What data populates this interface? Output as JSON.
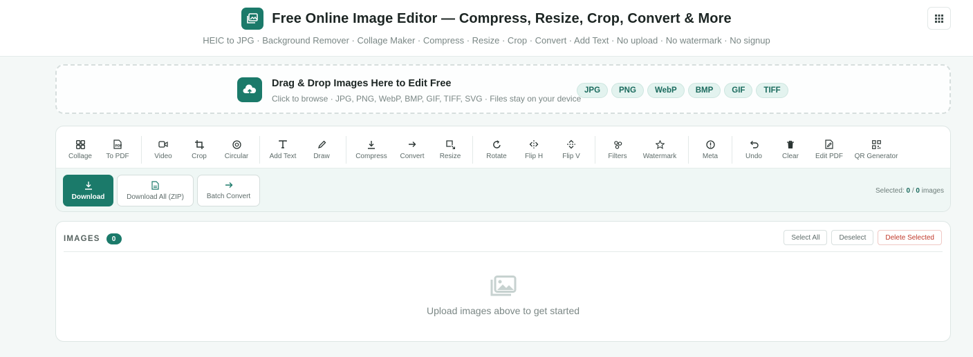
{
  "header": {
    "title": "Free Online Image Editor — Compress, Resize, Crop, Convert & More",
    "subtitle": "HEIC to JPG · Background Remover · Collage Maker · Compress · Resize · Crop · Convert · Add Text · No upload · No watermark · No signup",
    "logo_icon": "image-icon",
    "apps_icon": "grid-icon"
  },
  "dropzone": {
    "title": "Drag & Drop Images Here to Edit Free",
    "subtitle": "Click to browse · JPG, PNG, WebP, BMP, GIF, TIFF, SVG · Files stay on your device",
    "icon": "cloud-upload-icon",
    "formats": [
      "JPG",
      "PNG",
      "WebP",
      "BMP",
      "GIF",
      "TIFF"
    ]
  },
  "toolbar": {
    "tools": [
      {
        "label": "Collage",
        "icon": "grid-icon"
      },
      {
        "label": "To PDF",
        "icon": "pdf-icon"
      },
      {
        "label": "Video",
        "icon": "video-icon"
      },
      {
        "label": "Crop",
        "icon": "crop-icon"
      },
      {
        "label": "Circular",
        "icon": "circle-icon"
      },
      {
        "label": "Add Text",
        "icon": "text-icon"
      },
      {
        "label": "Draw",
        "icon": "pencil-icon"
      },
      {
        "label": "Compress",
        "icon": "download-icon"
      },
      {
        "label": "Convert",
        "icon": "arrow-right-icon"
      },
      {
        "label": "Resize",
        "icon": "resize-icon"
      },
      {
        "label": "Rotate",
        "icon": "rotate-icon"
      },
      {
        "label": "Flip H",
        "icon": "flip-h-icon"
      },
      {
        "label": "Flip V",
        "icon": "flip-v-icon"
      },
      {
        "label": "Filters",
        "icon": "filters-icon"
      },
      {
        "label": "Watermark",
        "icon": "star-icon"
      },
      {
        "label": "Meta",
        "icon": "info-icon"
      },
      {
        "label": "Undo",
        "icon": "undo-icon"
      },
      {
        "label": "Clear",
        "icon": "trash-icon"
      },
      {
        "label": "Edit PDF",
        "icon": "edit-pdf-icon"
      },
      {
        "label": "QR Generator",
        "icon": "qr-icon"
      }
    ]
  },
  "actions": {
    "download": "Download",
    "download_all": "Download All (ZIP)",
    "batch_convert": "Batch Convert",
    "selected_prefix": "Selected:",
    "selected_count": "0",
    "selected_sep": "/",
    "total_count": "0",
    "selected_suffix": "images"
  },
  "images": {
    "title": "IMAGES",
    "count": "0",
    "select_all": "Select All",
    "deselect": "Deselect",
    "delete_selected": "Delete Selected",
    "empty_text": "Upload images above to get started",
    "empty_icon": "images-icon"
  },
  "colors": {
    "accent": "#1b7a6a",
    "danger": "#c0392b",
    "chip_bg": "#e3f3ef"
  }
}
